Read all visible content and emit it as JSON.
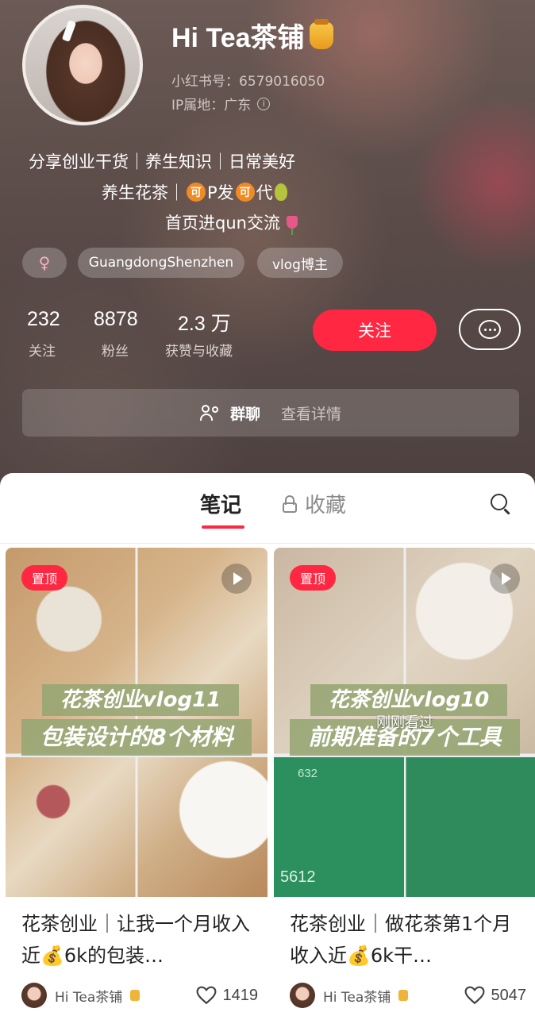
{
  "profile": {
    "name": "Hi Tea茶铺",
    "redbook_id": "小红书号：6579016050",
    "ip_location": "IP属地：广东",
    "bio_line1": "分享创业干货｜养生知识｜日常美好",
    "bio_line2_a": "养生花茶｜",
    "bio_line2_ke1": "可",
    "bio_line2_b": "P发",
    "bio_line2_ke2": "可",
    "bio_line2_c": "代",
    "bio_line3": "首页进qun交流",
    "tags": {
      "gender": "♀",
      "location": "GuangdongShenzhen",
      "role": "vlog博主"
    },
    "stats": [
      {
        "value": "232",
        "label": "关注"
      },
      {
        "value": "8878",
        "label": "粉丝"
      },
      {
        "value": "2.3 万",
        "label": "获赞与收藏"
      }
    ],
    "follow_label": "关注",
    "group_label": "群聊",
    "group_detail": "查看详情"
  },
  "tabs": {
    "notes": "笔记",
    "favorites": "收藏"
  },
  "cards": [
    {
      "pin_badge": "置顶",
      "cover_line1": "花茶创业vlog11",
      "cover_line2": "包装设计的8个材料",
      "title": "花茶创业｜让我一个月收入近💰6k的包装…",
      "author": "Hi Tea茶铺",
      "likes": "1419"
    },
    {
      "pin_badge": "置顶",
      "cover_line1": "花茶创业vlog10",
      "cover_line2": "前期准备的7个工具",
      "watched_overlay": "刚刚看过",
      "screen_num1": "5612",
      "screen_num2": "632",
      "title": "花茶创业｜做花茶第1个月收入近💰6k干…",
      "author": "Hi Tea茶铺",
      "likes": "5047"
    }
  ],
  "colors": {
    "accent": "#ff2741",
    "banner": "#96a573",
    "header_bg": "#5a4b48"
  }
}
